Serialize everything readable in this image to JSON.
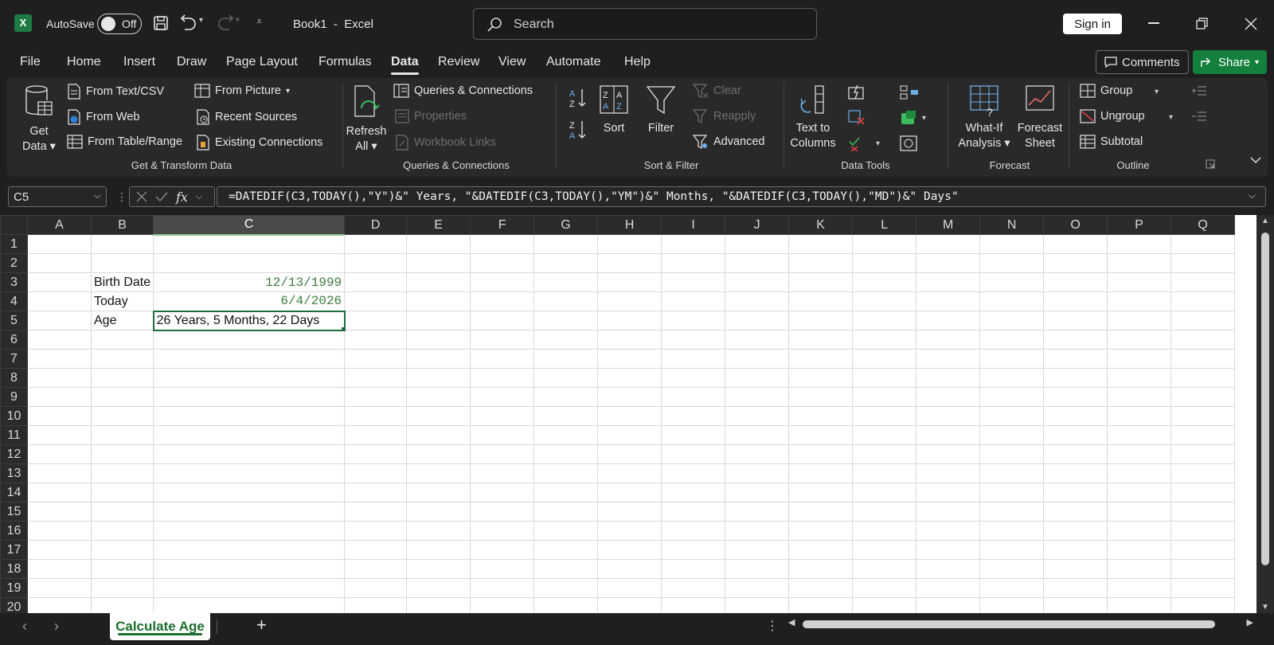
{
  "titlebar": {
    "autosave_label": "AutoSave",
    "autosave_state": "Off",
    "doc_name": "Book1",
    "separator": "-",
    "app_name": "Excel",
    "search_placeholder": "Search",
    "signin_label": "Sign in"
  },
  "tabs": [
    "File",
    "Home",
    "Insert",
    "Draw",
    "Page Layout",
    "Formulas",
    "Data",
    "Review",
    "View",
    "Automate",
    "Help"
  ],
  "active_tab": "Data",
  "actions": {
    "comments": "Comments",
    "share": "Share"
  },
  "ribbon": {
    "get_data": {
      "line1": "Get",
      "line2": "Data"
    },
    "from_text_csv": "From Text/CSV",
    "from_web": "From Web",
    "from_table_range": "From Table/Range",
    "from_picture": "From Picture",
    "recent_sources": "Recent Sources",
    "existing_connections": "Existing Connections",
    "group_get_transform": "Get & Transform Data",
    "refresh_all": {
      "line1": "Refresh",
      "line2": "All"
    },
    "queries_connections": "Queries & Connections",
    "properties": "Properties",
    "workbook_links": "Workbook Links",
    "group_queries": "Queries & Connections",
    "sort": "Sort",
    "filter": "Filter",
    "clear": "Clear",
    "reapply": "Reapply",
    "advanced": "Advanced",
    "group_sort_filter": "Sort & Filter",
    "text_to_columns": {
      "line1": "Text to",
      "line2": "Columns"
    },
    "group_data_tools": "Data Tools",
    "what_if": {
      "line1": "What-If",
      "line2": "Analysis"
    },
    "forecast_sheet": {
      "line1": "Forecast",
      "line2": "Sheet"
    },
    "group_forecast": "Forecast",
    "group": "Group",
    "ungroup": "Ungroup",
    "subtotal": "Subtotal",
    "group_outline": "Outline"
  },
  "formula_bar": {
    "name_box": "C5",
    "fx": "fx",
    "formula": "=DATEDIF(C3,TODAY(),\"Y\")&\" Years, \"&DATEDIF(C3,TODAY(),\"YM\")&\" Months, \"&DATEDIF(C3,TODAY(),\"MD\")&\" Days\""
  },
  "sheet": {
    "columns": [
      "A",
      "B",
      "C",
      "D",
      "E",
      "F",
      "G",
      "H",
      "I",
      "J",
      "K",
      "L",
      "M",
      "N",
      "O",
      "P",
      "Q"
    ],
    "rows": [
      "1",
      "2",
      "3",
      "4",
      "5",
      "6",
      "7",
      "8",
      "9",
      "10",
      "11",
      "12",
      "13",
      "14",
      "15",
      "16",
      "17",
      "18",
      "19",
      "20"
    ],
    "cells": {
      "B3": "Birth Date",
      "C3": "12/13/1999",
      "B4": "Today",
      "C4": "6/4/2026",
      "B5": "Age",
      "C5": "26 Years, 5 Months, 22 Days"
    },
    "selected_cell": "C5",
    "selected_column": "C"
  },
  "status": {
    "sheet_tab": "Calculate Age"
  },
  "colors": {
    "accent_green": "#1e6c3a",
    "share_green": "#15803d",
    "date_text": "#3c7d3c"
  }
}
